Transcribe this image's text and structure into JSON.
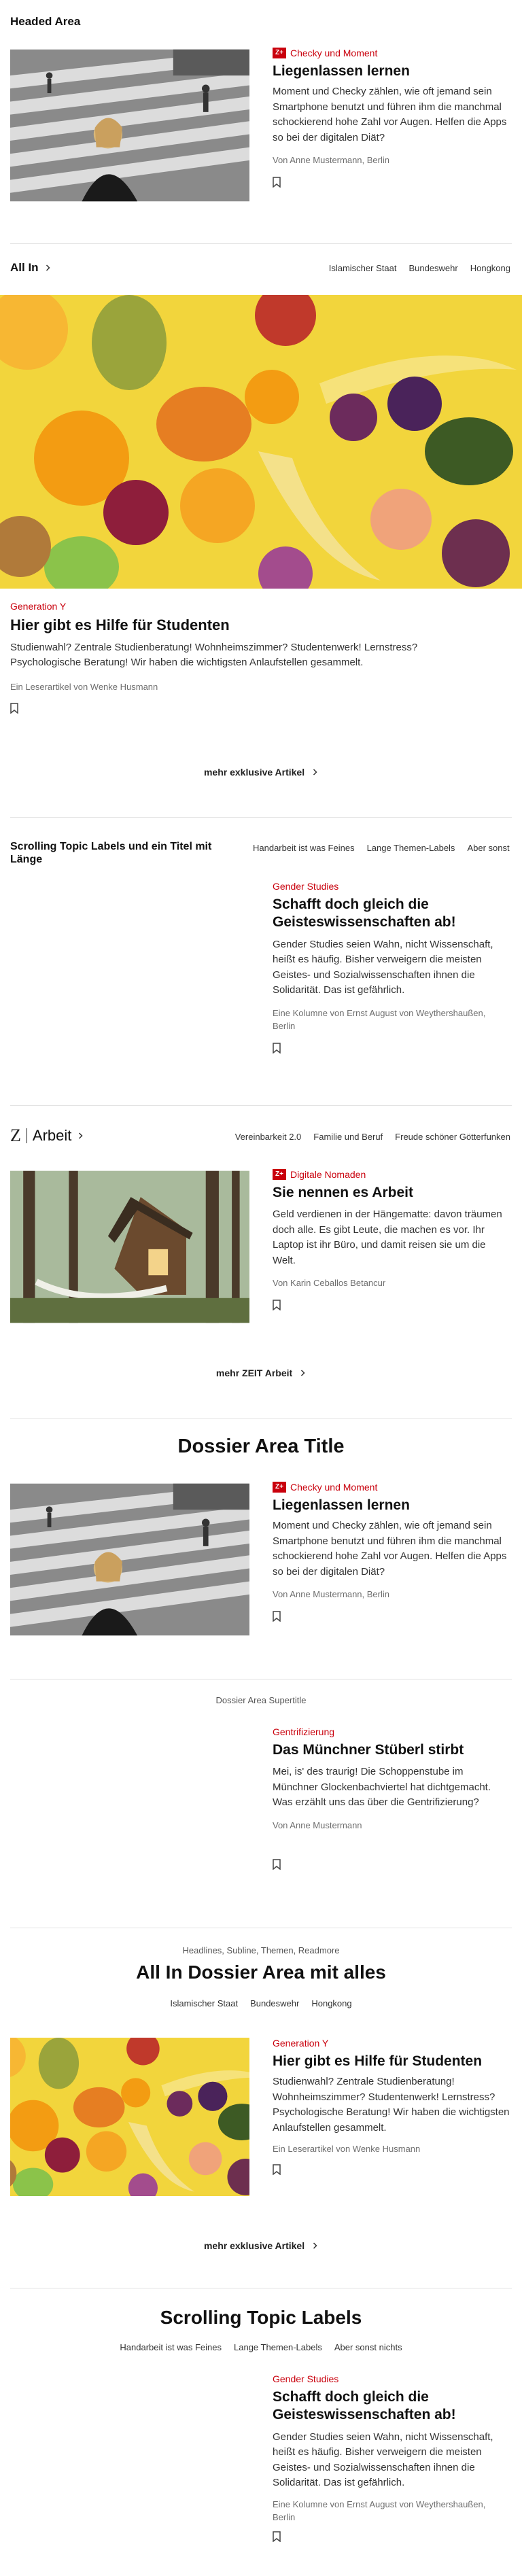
{
  "section1": {
    "title": "Headed Area",
    "article": {
      "kicker": "Checky und Moment",
      "headline": "Liegenlassen lernen",
      "teaser": "Moment und Checky zählen, wie oft jemand sein Smartphone benutzt und führen ihm die manchmal schockierend hohe Zahl vor Augen. Helfen die Apps so bei der digitalen Diät?",
      "byline": "Von Anne Mustermann, Berlin"
    }
  },
  "section2": {
    "title": "All In",
    "tags": [
      "Islamischer Staat",
      "Bundeswehr",
      "Hongkong"
    ],
    "article": {
      "kicker": "Generation Y",
      "headline": "Hier gibt es Hilfe für Studenten",
      "teaser": "Studienwahl? Zentrale Studienberatung! Wohnheimszimmer? Studentenwerk! Lernstress? Psychologische Beratung! Wir haben die wichtigsten Anlaufstellen gesammelt.",
      "byline": "Ein Leserartikel von Wenke Husmann"
    },
    "more": "mehr exklusive Artikel"
  },
  "section3": {
    "title": "Scrolling Topic Labels und ein Titel mit Länge",
    "tags": [
      "Handarbeit ist was Feines",
      "Lange Themen-Labels",
      "Aber sonst"
    ],
    "article": {
      "kicker": "Gender Studies",
      "headline": "Schafft doch gleich die Geisteswissenschaften ab!",
      "teaser": "Gender Studies seien Wahn, nicht Wissenschaft, heißt es häufig. Bisher verweigern die meisten Geistes- und Sozialwissenschaften ihnen die Solidarität. Das ist gefährlich.",
      "byline": "Eine Kolumne von Ernst August von Weythershaußen, Berlin"
    }
  },
  "section4": {
    "logo": "Z",
    "title": "Arbeit",
    "tags": [
      "Vereinbarkeit 2.0",
      "Familie und Beruf",
      "Freude schöner Götterfunken"
    ],
    "article": {
      "kicker": "Digitale Nomaden",
      "headline": "Sie nennen es Arbeit",
      "teaser": "Geld verdienen in der Hängematte: davon träumen doch alle. Es gibt Leute, die machen es vor. Ihr Laptop ist ihr Büro, und damit reisen sie um die Welt.",
      "byline": "Von Karin Ceballos Betancur"
    },
    "more": "mehr ZEIT Arbeit"
  },
  "section5": {
    "title": "Dossier Area Title",
    "article": {
      "kicker": "Checky und Moment",
      "headline": "Liegenlassen lernen",
      "teaser": "Moment und Checky zählen, wie oft jemand sein Smartphone benutzt und führen ihm die manchmal schockierend hohe Zahl vor Augen. Helfen die Apps so bei der digitalen Diät?",
      "byline": "Von Anne Mustermann, Berlin"
    }
  },
  "section6": {
    "supertitle": "Dossier Area Supertitle",
    "article": {
      "kicker": "Gentrifizierung",
      "headline": "Das Münchner Stüberl stirbt",
      "teaser": "Mei, is' des traurig! Die Schoppenstube im Münchner Glockenbachviertel hat dichtgemacht. Was erzählt uns das über die Gentrifizierung?",
      "byline": "Von Anne Mustermann"
    }
  },
  "section7": {
    "supertitle": "Headlines, Subline, Themen, Readmore",
    "title": "All In Dossier Area mit alles",
    "tags": [
      "Islamischer Staat",
      "Bundeswehr",
      "Hongkong"
    ],
    "article": {
      "kicker": "Generation Y",
      "headline": "Hier gibt es Hilfe für Studenten",
      "teaser": "Studienwahl? Zentrale Studienberatung! Wohnheimszimmer? Studentenwerk! Lernstress? Psychologische Beratung! Wir haben die wichtigsten Anlaufstellen gesammelt.",
      "byline": "Ein Leserartikel von Wenke Husmann"
    },
    "more": "mehr exklusive Artikel"
  },
  "section8": {
    "title": "Scrolling Topic Labels",
    "tags": [
      "Handarbeit ist was Feines",
      "Lange Themen-Labels",
      "Aber sonst nichts"
    ],
    "article": {
      "kicker": "Gender Studies",
      "headline": "Schafft doch gleich die Geisteswissenschaften ab!",
      "teaser": "Gender Studies seien Wahn, nicht Wissenschaft, heißt es häufig. Bisher verweigern die meisten Geistes- und Sozialwissenschaften ihnen die Solidarität. Das ist gefährlich.",
      "byline": "Eine Kolumne von Ernst August von Weythershaußen, Berlin"
    }
  },
  "badge": "Z+",
  "colors": {
    "accent": "#c9000c",
    "text": "#252525",
    "divider": "#e3e3e3",
    "fruit_bg": "#f2d53c"
  },
  "icons": [
    "chevron-right-icon",
    "bookmark-icon",
    "zeit-logo-icon"
  ]
}
